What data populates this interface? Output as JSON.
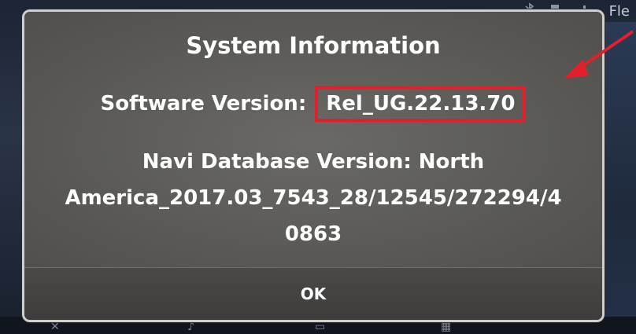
{
  "status_bar": {
    "icons": [
      "bluetooth-icon",
      "battery-icon",
      "signal-icon"
    ],
    "clock_partial": "Fle"
  },
  "dialog": {
    "title": "System Information",
    "software_version_label": "Software Version:",
    "software_version_value": "Rel_UG.22.13.70",
    "navi_label": "Navi Database Version: North",
    "navi_line2": "America_2017.03_7543_28/12545/272294/4",
    "navi_line3": "0863",
    "ok_label": "OK"
  },
  "annotation": {
    "color": "#e0202a",
    "type": "arrow-icon"
  },
  "colors": {
    "dialog_bg": "#5b5a58",
    "dialog_border": "#cfcfcf",
    "highlight_box": "#e0202a",
    "text": "#ffffff"
  }
}
